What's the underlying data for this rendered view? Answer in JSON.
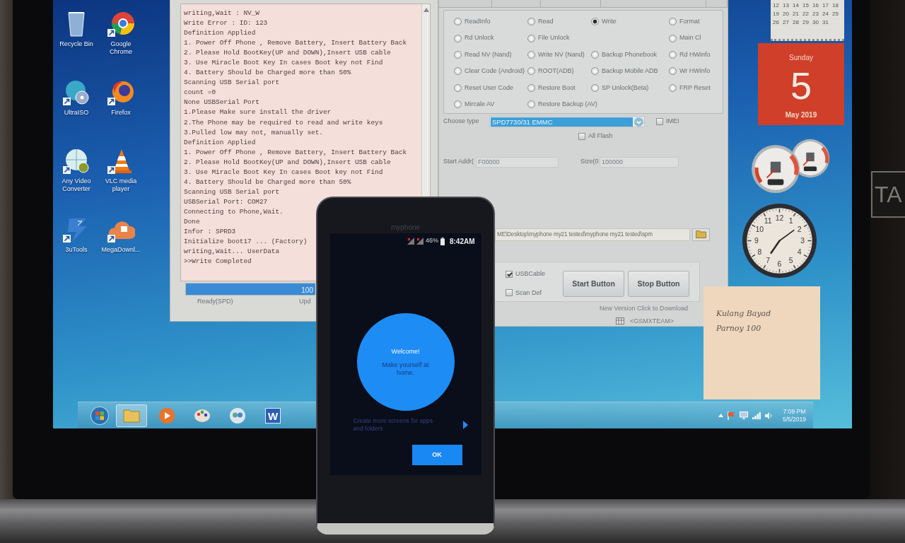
{
  "wall_sign": "TA",
  "desktop": {
    "icons": [
      {
        "kind": "bin",
        "label": "Recycle Bin"
      },
      {
        "kind": "chrome",
        "label": "Google Chrome"
      },
      {
        "kind": "disc",
        "label": "UltraISO"
      },
      {
        "kind": "fox",
        "label": "Firefox"
      },
      {
        "kind": "converter",
        "label": "Any Video Converter"
      },
      {
        "kind": "cone",
        "label": "VLC media player"
      },
      {
        "kind": "tools",
        "label": "3uTools"
      },
      {
        "kind": "cloud",
        "label": "MegaDownl..."
      }
    ]
  },
  "log_window": {
    "lines": [
      "writing,Wait : NV_W",
      "Write Error : ID: 123",
      "Definition Applied",
      "1. Power Off Phone , Remove Battery, Insert Battery Back",
      "2. Please Hold BootKey(UP and DOWN),Insert USB cable",
      "3. Use Miracle Boot Key In cases Boot key not Find",
      "4. Battery Should be Charged more than 50%",
      "Scanning USB Serial port",
      "count =0",
      "None USBSerial Port",
      "1.Please Make sure install the driver",
      "2.The Phone may be required to read and write keys",
      "3.Pulled low may not, manually set.",
      "Definition Applied",
      "1. Power Off Phone , Remove Battery, Insert Battery Back",
      "2. Please Hold BootKey(UP and DOWN),Insert USB cable",
      "3. Use Miracle Boot Key In cases Boot key not Find",
      "4. Battery Should be Charged more than 50%",
      "Scanning USB Serial port",
      "USBSerial Port: COM27",
      "Connecting to Phone,Wait.",
      "Done",
      "Infor : SPRD3",
      "Initialize boot17 ... (Factory)",
      "writing,Wait... UserData",
      ">>Write Completed"
    ],
    "progress": {
      "level": 1,
      "text": "100"
    },
    "status": [
      "Ready(SPD)",
      "Upd"
    ]
  },
  "tool_window": {
    "operations": [
      [
        {
          "label": "ReadInfo",
          "selected": false
        },
        {
          "label": "Read",
          "selected": false
        },
        {
          "label": "Write",
          "selected": true
        },
        {
          "label": "Format",
          "selected": false
        }
      ],
      [
        {
          "label": "Rd Unlock",
          "selected": false
        },
        {
          "label": "File Unlock",
          "selected": false
        },
        {
          "label": "Main Cl",
          "selected": false
        }
      ],
      [
        {
          "label": "Read NV (Nand)",
          "selected": false
        },
        {
          "label": "Write NV (Nand)",
          "selected": false
        },
        {
          "label": "Backup Phonebook",
          "selected": false
        },
        {
          "label": "Rd HWinfo",
          "selected": false
        }
      ],
      [
        {
          "label": "Clear Code (Android)",
          "selected": false
        },
        {
          "label": "ROOT(ADB)",
          "selected": false
        },
        {
          "label": "Backup Mobile ADB",
          "selected": false
        },
        {
          "label": "Wr HWinfo",
          "selected": false
        }
      ],
      [
        {
          "label": "Reset User Code",
          "selected": false
        },
        {
          "label": "Restore Boot",
          "selected": false
        },
        {
          "label": "SP Unlock(Beta)",
          "selected": false
        },
        {
          "label": "FRP Reset",
          "selected": false
        }
      ],
      [
        {
          "label": "Mircale AV",
          "selected": false
        },
        {
          "label": "Restore Backup (AV)",
          "selected": false
        }
      ]
    ],
    "chip_type": {
      "label": "Choose type",
      "value": "SPD7730/31 EMMC"
    },
    "imei": {
      "label": "IMEI",
      "checked": false
    },
    "all_flash": {
      "label": "All Flash",
      "checked": false
    },
    "start_address": {
      "label": "Start Addr(",
      "value": "F00000"
    },
    "size": {
      "label": "Size(0",
      "value": "100000"
    },
    "file_path": "ME\\Desktop\\myphone my21 tested\\myphone my21 tested\\spm",
    "options": [
      {
        "label": "USBCable",
        "checked": true
      },
      {
        "label": "Scan Def",
        "checked": false
      }
    ],
    "buttons": [
      "Start Button",
      "Stop Button"
    ],
    "update_link": "New Version Click to Download",
    "team": "<GSMXTEAM>"
  },
  "gadgets": {
    "calendar": {
      "weeks": [
        [
          "12",
          "13",
          "14",
          "15",
          "16",
          "17",
          "18"
        ],
        [
          "19",
          "20",
          "21",
          "22",
          "23",
          "24",
          "25"
        ],
        [
          "26",
          "27",
          "28",
          "29",
          "30",
          "31"
        ]
      ],
      "weekday": "Sunday",
      "day": "5",
      "month": "May 2019"
    },
    "clock": {
      "numerals": [
        "12",
        "11",
        "1",
        "10",
        "2",
        "9",
        "3",
        "8",
        "4",
        "7",
        "5",
        "6"
      ]
    },
    "note": [
      "Kulang Bayad",
      "Parnoy 100"
    ]
  },
  "taskbar": {
    "apps": [
      {
        "kind": "folder",
        "selected": true
      },
      {
        "kind": "player",
        "selected": false
      },
      {
        "kind": "paint",
        "selected": false
      },
      {
        "kind": "chat",
        "selected": false
      },
      {
        "kind": "word",
        "glyph": "W",
        "selected": false
      }
    ],
    "time": "7:09 PM",
    "date": "5/5/2019"
  },
  "phone": {
    "brand": "myphone",
    "battery": "46%",
    "time": "8:42AM",
    "welcome_title": "Welcome!",
    "welcome_message": "Make yourself at home.",
    "hint": "Create more screens for apps and folders",
    "ok": "OK"
  }
}
